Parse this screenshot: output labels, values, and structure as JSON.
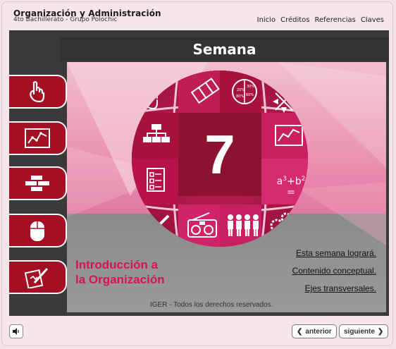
{
  "course": {
    "title": "Organización y Administración",
    "subtitle": "4to Bachillerato - Grupo Polochic"
  },
  "nav": [
    "Inicio",
    "Créditos",
    "Referencias",
    "Claves"
  ],
  "header": {
    "title": "Semana"
  },
  "week": {
    "number": "7"
  },
  "topic": {
    "line1": "Introducción a",
    "line2": "la Organización"
  },
  "links": {
    "goals": "Esta semana logrará.",
    "content": "Contenido conceptual.",
    "transversal": "Ejes transversales."
  },
  "footer": {
    "text": "IGER - Todos los derechos reservados."
  },
  "bottom": {
    "prev": "anterior",
    "next": "siguiente"
  },
  "colors": {
    "accent": "#d4145a",
    "sidebar": "#a50f24",
    "dark_bar": "#333333"
  },
  "sidebar_icons": [
    "hand-pointing-icon",
    "line-chart-icon",
    "brick-wall-icon",
    "mouse-icon",
    "pen-writing-icon"
  ],
  "sphere_tiles": {
    "chart_labels": [
      "20%",
      "30%",
      "60%",
      "80%"
    ],
    "math_formula": {
      "base1": "a",
      "exp1": "3",
      "op": "+",
      "base2": "b",
      "exp2": "2",
      "eq": "="
    }
  }
}
